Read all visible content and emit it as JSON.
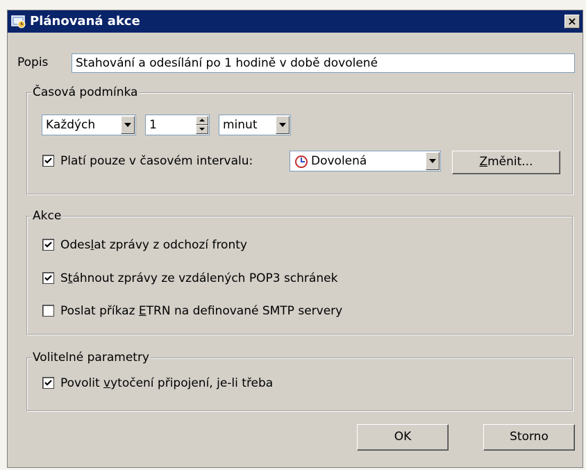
{
  "window": {
    "title": "Plánovaná akce",
    "close_glyph": "×",
    "icon": "scheduler-app-icon"
  },
  "popis": {
    "label": "Popis",
    "value": "Stahování a odesílání po 1 hodině v době dovolené"
  },
  "time_condition": {
    "legend": "Časová podmínka",
    "frequency": {
      "selected": "Každých"
    },
    "count": {
      "value": "1"
    },
    "unit": {
      "selected": "minut"
    },
    "interval_check": {
      "checked": true,
      "label": "Platí pouze v časovém intervalu:"
    },
    "interval": {
      "selected": "Dovolená",
      "icon": "calendar-clock-icon"
    },
    "change_button": {
      "label_pre": "",
      "label_u": "Z",
      "label_post": "měnit..."
    }
  },
  "actions": {
    "legend": "Akce",
    "items": [
      {
        "checked": true,
        "pre": "Odes",
        "u": "l",
        "post": "at zprávy z odchozí fronty"
      },
      {
        "checked": true,
        "pre": "S",
        "u": "t",
        "post": "áhnout zprávy ze vzdálených POP3 schránek"
      },
      {
        "checked": false,
        "pre": "Poslat příkaz ",
        "u": "E",
        "post": "TRN na definované SMTP servery"
      }
    ]
  },
  "optional": {
    "legend": "Volitelné parametry",
    "dial": {
      "checked": true,
      "pre": "Povolit ",
      "u": "v",
      "post": "ytočení připojení, je-li třeba"
    }
  },
  "buttons": {
    "ok": "OK",
    "cancel": "Storno"
  }
}
